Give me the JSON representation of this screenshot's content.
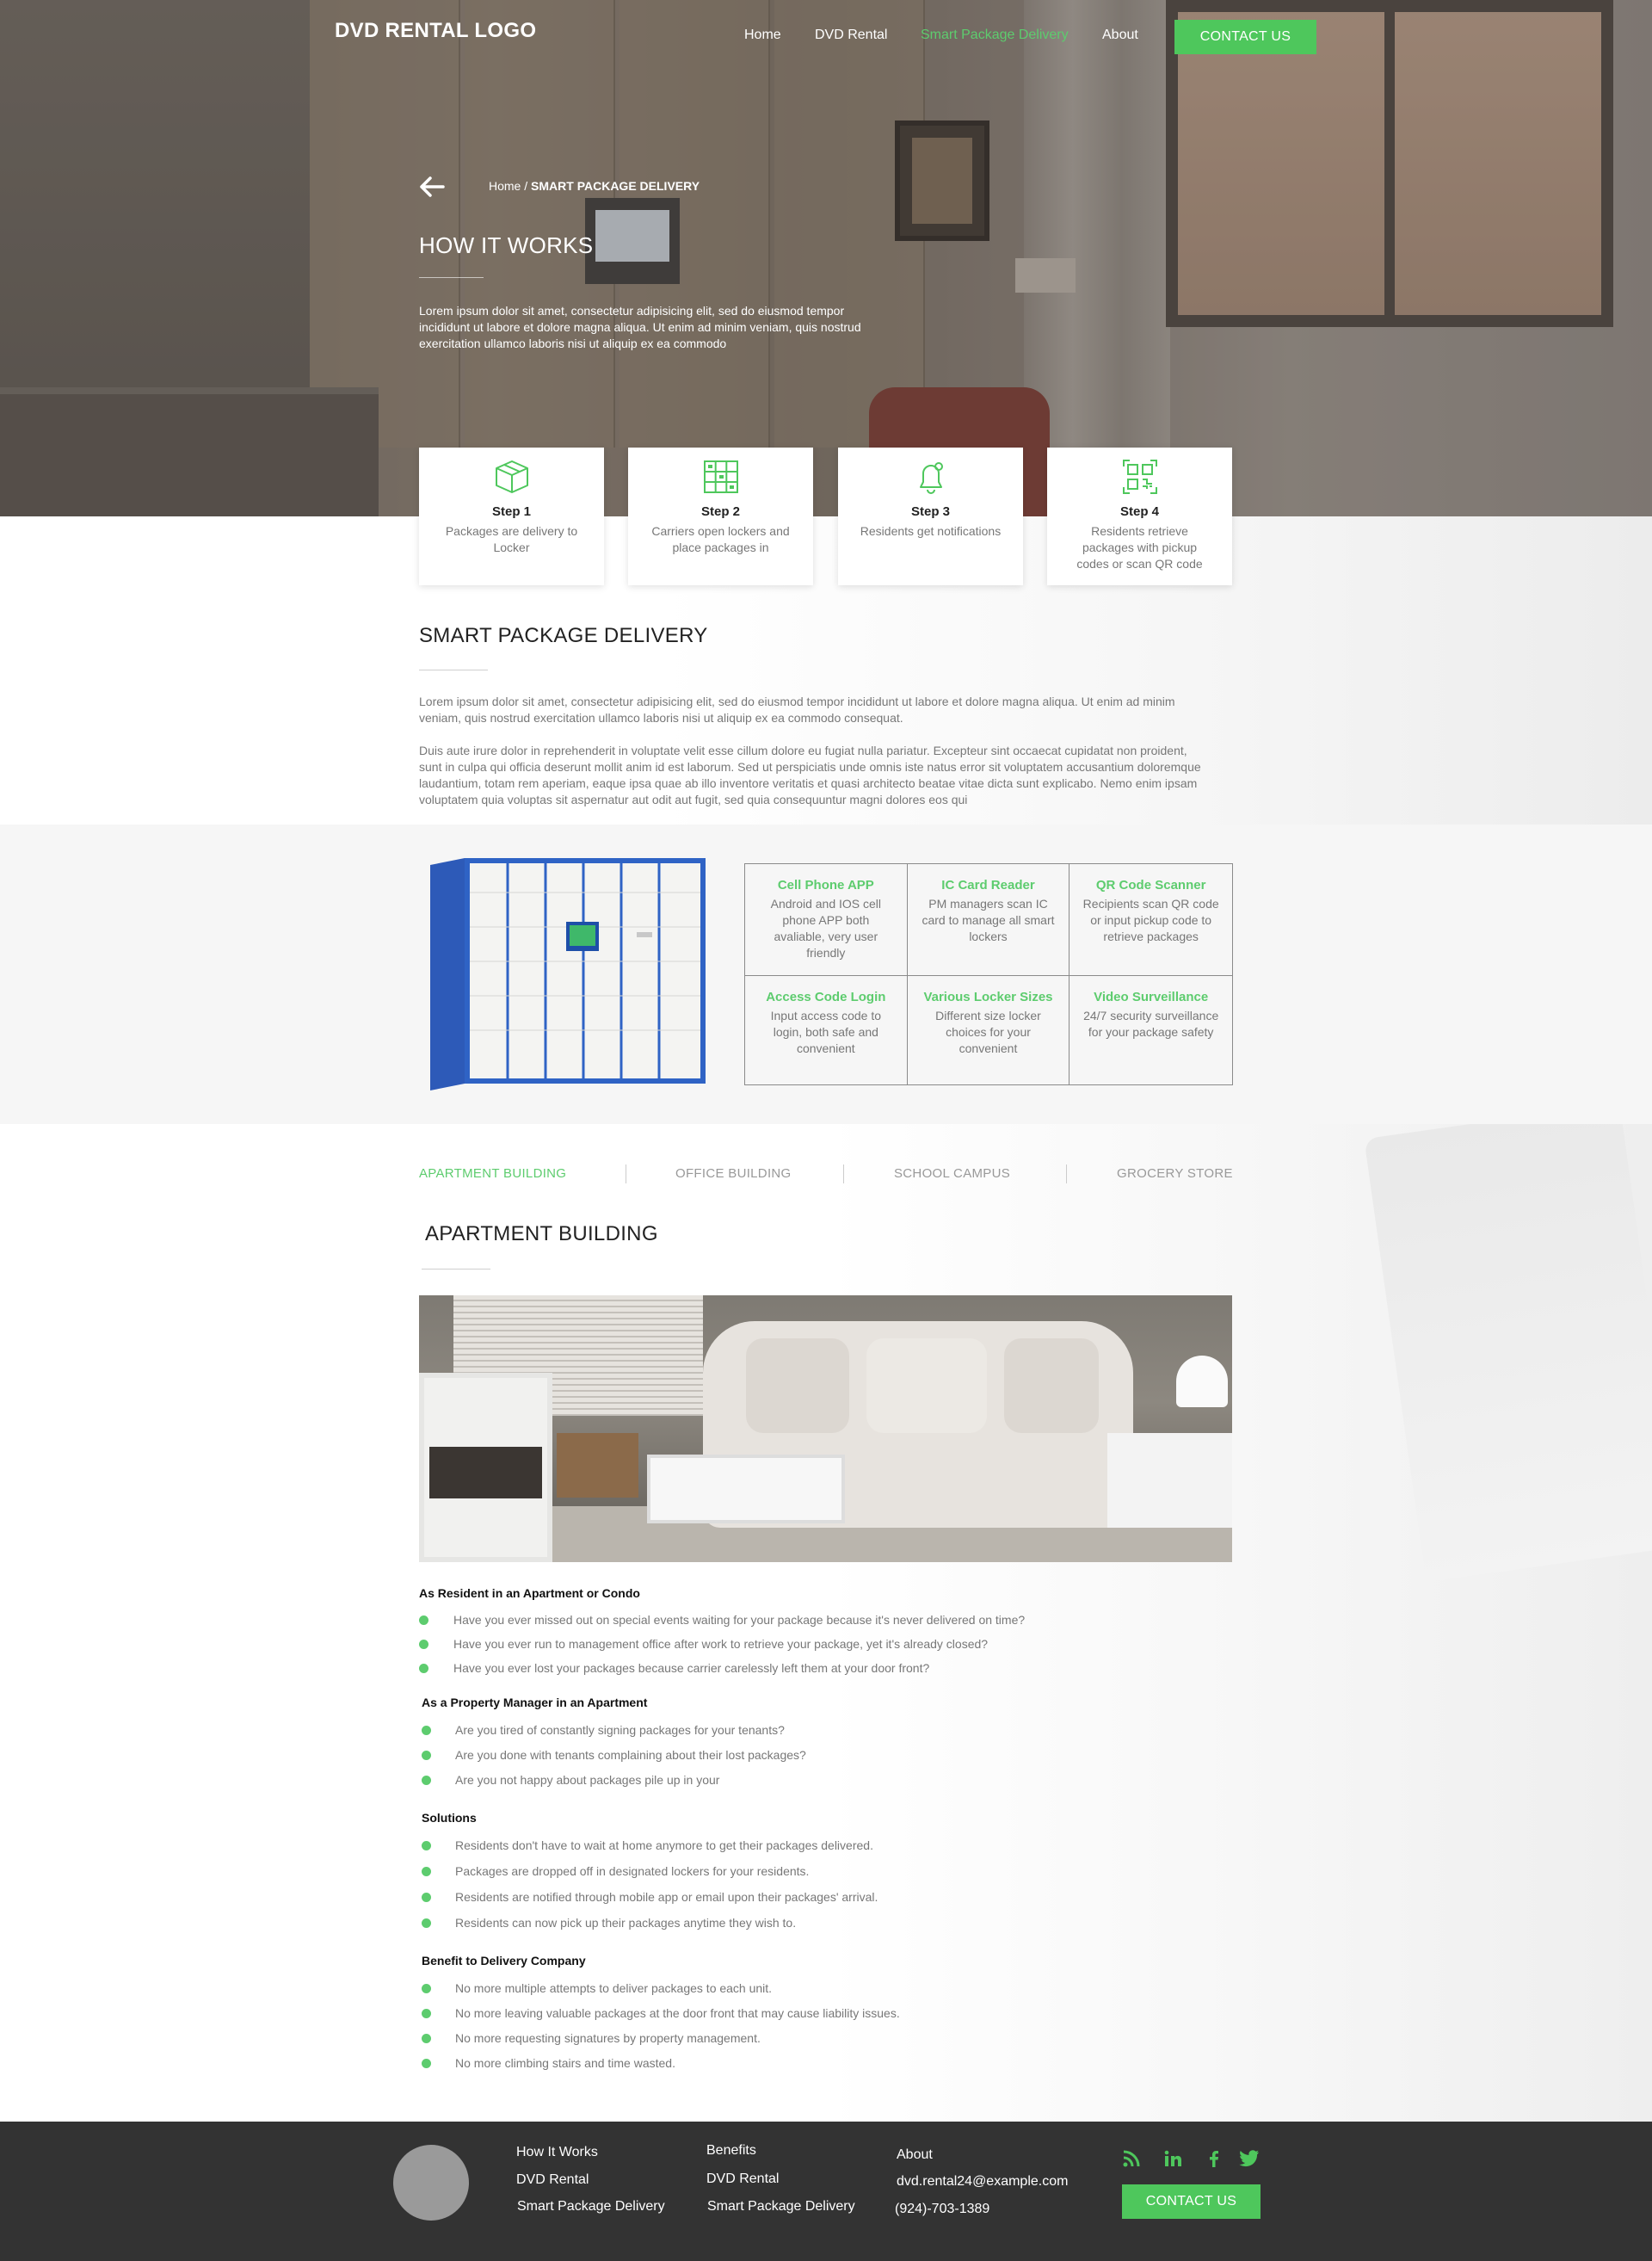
{
  "header": {
    "logo": "DVD RENTAL LOGO",
    "nav": [
      {
        "label": "Home",
        "active": false
      },
      {
        "label": "DVD Rental",
        "active": false
      },
      {
        "label": "Smart Package Delivery",
        "active": true
      },
      {
        "label": "About",
        "active": false
      }
    ],
    "contact_button": "CONTACT US"
  },
  "hero": {
    "breadcrumb_home": "Home",
    "breadcrumb_sep": " / ",
    "breadcrumb_current": "SMART PACKAGE DELIVERY",
    "title": "HOW IT WORKS",
    "text": "Lorem ipsum dolor sit amet, consectetur adipisicing elit, sed do eiusmod tempor incididunt ut labore et dolore magna aliqua. Ut enim ad minim veniam, quis nostrud exercitation ullamco laboris nisi ut aliquip ex ea commodo"
  },
  "steps": [
    {
      "title": "Step 1",
      "desc": "Packages are delivery to Locker",
      "icon": "package-box-icon"
    },
    {
      "title": "Step 2",
      "desc": "Carriers open lockers and place packages in",
      "icon": "locker-grid-icon"
    },
    {
      "title": "Step 3",
      "desc": "Residents get notifications",
      "icon": "bell-notification-icon"
    },
    {
      "title": "Step 4",
      "desc": "Residents retrieve packages with pickup codes or scan QR code",
      "icon": "qr-code-icon"
    }
  ],
  "smart": {
    "title": "SMART PACKAGE DELIVERY",
    "p1": "Lorem ipsum dolor sit amet, consectetur adipisicing elit, sed do eiusmod tempor incididunt ut labore et dolore magna aliqua. Ut enim ad minim veniam, quis nostrud exercitation ullamco laboris nisi ut aliquip ex ea commodo consequat.",
    "p2": "Duis aute irure dolor in reprehenderit in voluptate velit esse cillum dolore eu fugiat nulla pariatur. Excepteur sint occaecat cupidatat non proident, sunt in culpa qui officia deserunt mollit anim id est laborum. Sed ut perspiciatis unde omnis iste natus error sit voluptatem accusantium doloremque laudantium, totam rem aperiam, eaque ipsa quae ab illo inventore veritatis et quasi architecto beatae vitae dicta sunt explicabo. Nemo enim ipsam voluptatem quia voluptas sit aspernatur aut odit aut fugit, sed quia consequuntur magni dolores eos qui"
  },
  "features": [
    {
      "title": "Cell Phone APP",
      "desc": "Android and IOS cell phone APP both avaliable, very user friendly"
    },
    {
      "title": "IC Card Reader",
      "desc": "PM managers scan IC card to manage all smart lockers"
    },
    {
      "title": "QR Code Scanner",
      "desc": "Recipients scan QR code or input pickup code to retrieve packages"
    },
    {
      "title": "Access Code Login",
      "desc": "Input access code to login, both safe and convenient"
    },
    {
      "title": "Various Locker Sizes",
      "desc": "Different size locker choices for your convenient"
    },
    {
      "title": "Video Surveillance",
      "desc": "24/7 security surveillance for your package safety"
    }
  ],
  "tabs": [
    {
      "label": "APARTMENT BUILDING",
      "active": true
    },
    {
      "label": "OFFICE BUILDING",
      "active": false
    },
    {
      "label": "SCHOOL CAMPUS",
      "active": false
    },
    {
      "label": "GROCERY STORE",
      "active": false
    }
  ],
  "apartment": {
    "title": "APARTMENT BUILDING",
    "sections": [
      {
        "heading": "As Resident in an Apartment or Condo",
        "items": [
          "Have you ever missed out on special events waiting for your package because it's never delivered on time?",
          "Have you ever run to management office after work to retrieve your package, yet it's already closed?",
          "Have you ever lost your packages because carrier carelessly left them at your door front?"
        ]
      },
      {
        "heading": "As a Property Manager in an Apartment",
        "items": [
          "Are you tired of constantly signing packages for your tenants?",
          "Are you done with tenants complaining about their lost packages?",
          "Are you not happy about packages pile up in your"
        ]
      },
      {
        "heading": "Solutions",
        "items": [
          "Residents don't have to wait at home anymore to get their packages delivered.",
          "Packages are dropped off in designated lockers for your residents.",
          "Residents are notified through mobile app or email upon their packages' arrival.",
          "Residents can now pick up their packages anytime they wish to."
        ]
      },
      {
        "heading": "Benefit to Delivery Company",
        "items": [
          "No more multiple attempts to deliver packages to each unit.",
          "No more leaving valuable packages at the door front that may cause liability issues.",
          "No more requesting signatures by property management.",
          "No more climbing stairs and time wasted."
        ]
      }
    ]
  },
  "footer": {
    "col1": [
      "How It Works",
      "DVD Rental",
      "Smart Package Delivery"
    ],
    "col2": [
      "Benefits",
      "DVD Rental",
      "Smart Package Delivery"
    ],
    "about": "About",
    "email": "dvd.rental24@example.com",
    "phone": "(924)-703-1389",
    "contact_button": "CONTACT US",
    "social": [
      "rss-icon",
      "linkedin-icon",
      "facebook-icon",
      "twitter-icon"
    ]
  },
  "colors": {
    "accent": "#4ec75c",
    "footer_bg": "#333333"
  }
}
